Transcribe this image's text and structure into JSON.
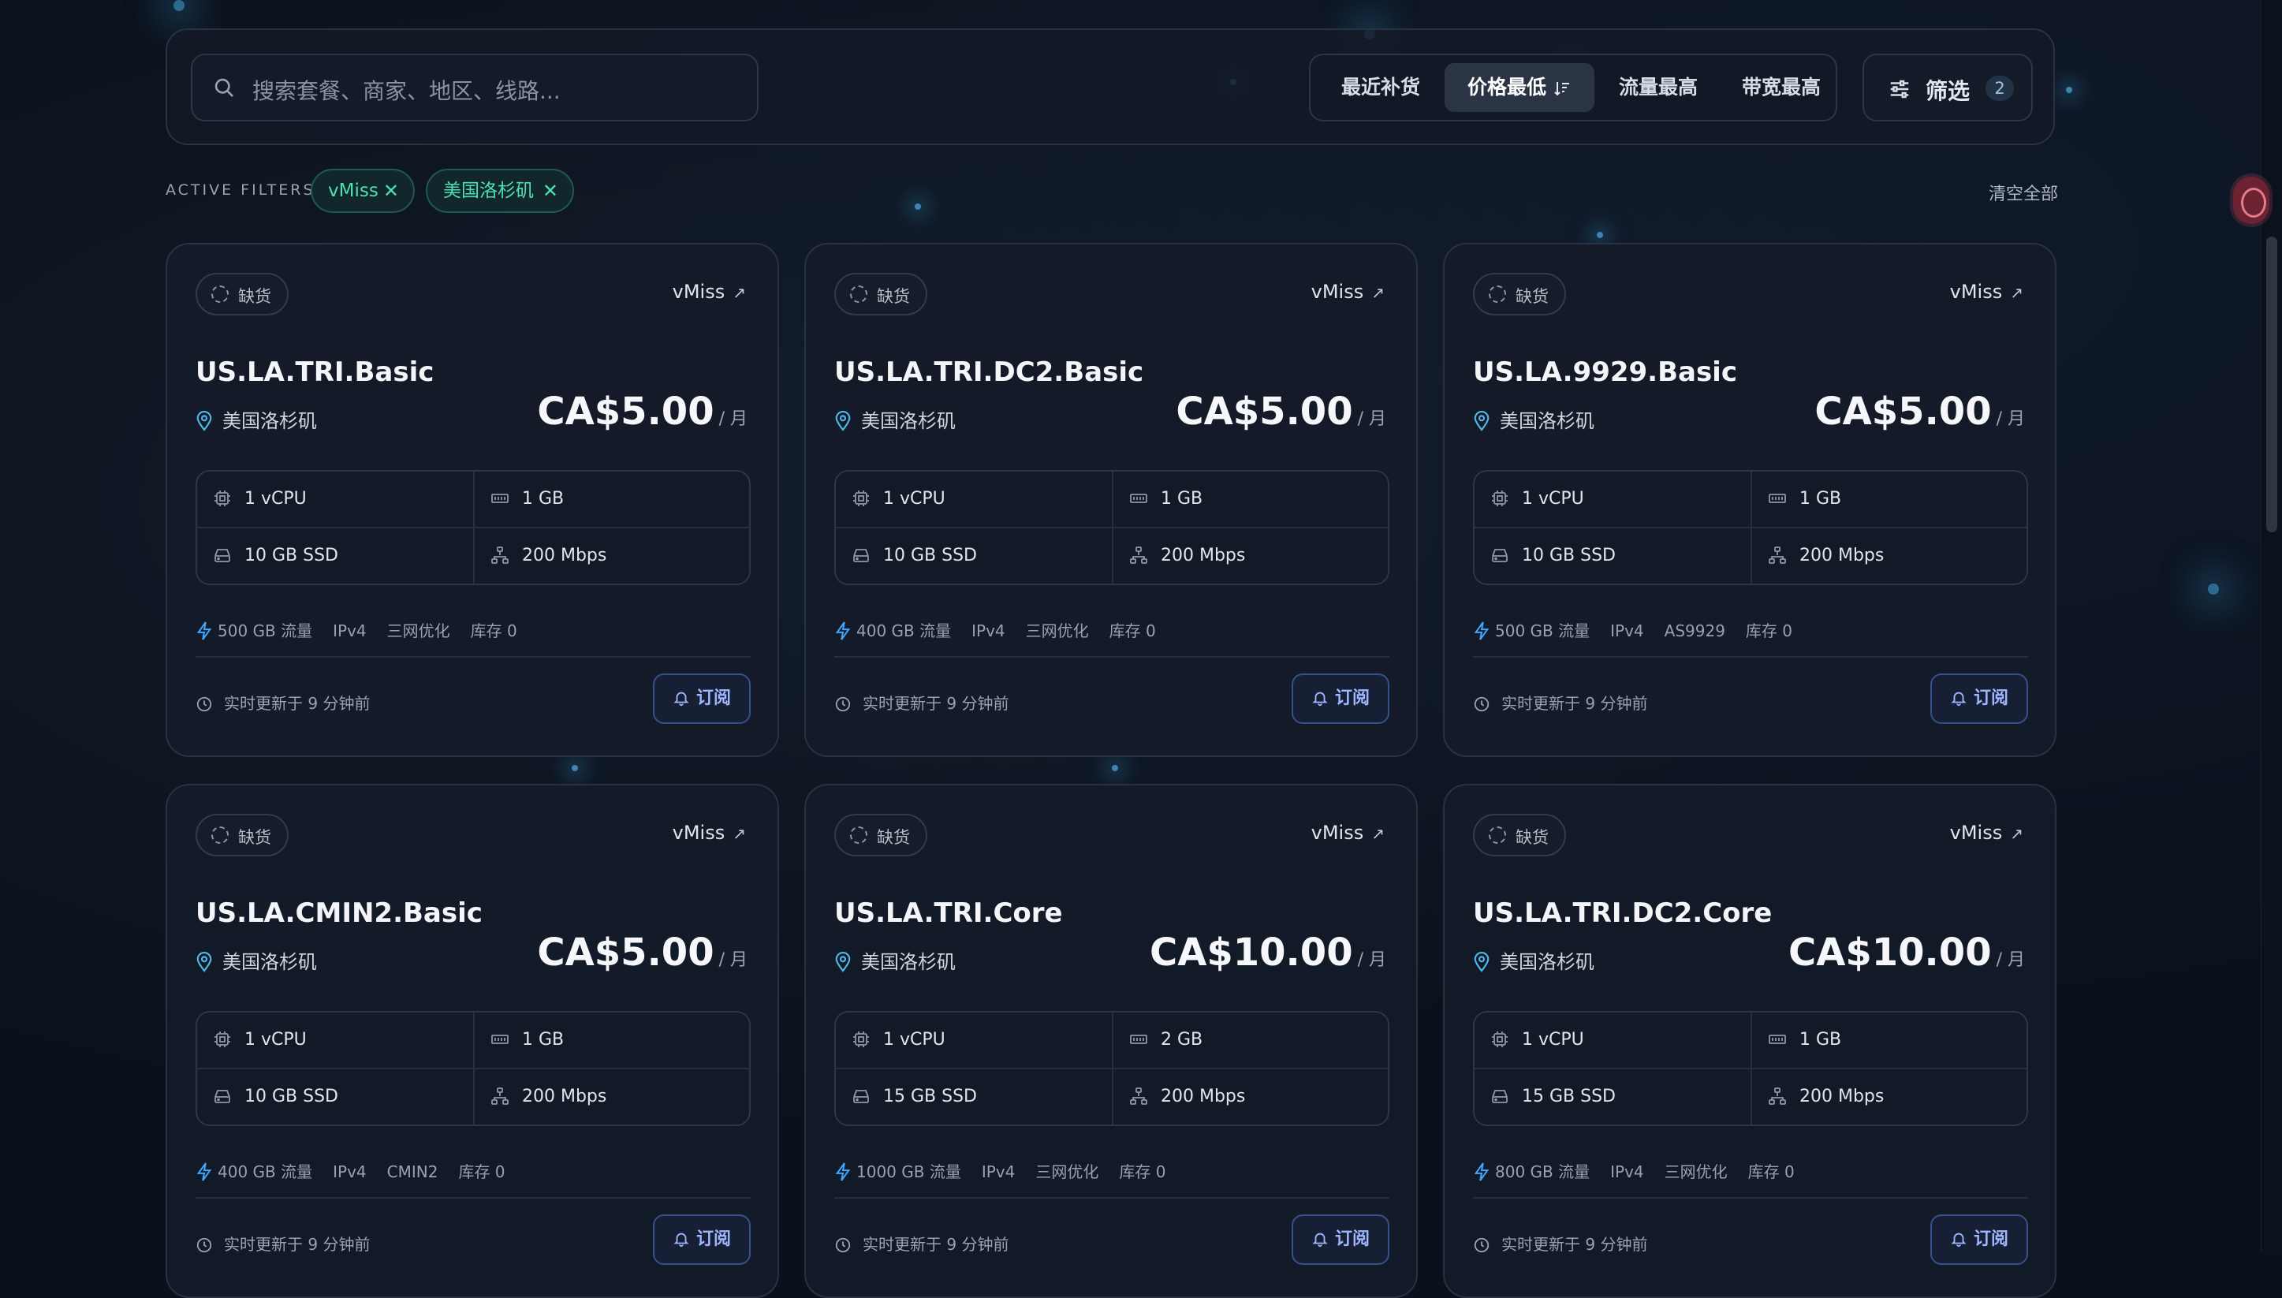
{
  "search": {
    "placeholder": "搜索套餐、商家、地区、线路..."
  },
  "sort": {
    "options": [
      {
        "label": "最近补货"
      },
      {
        "label": "价格最低",
        "active": true
      },
      {
        "label": "流量最高"
      },
      {
        "label": "带宽最高"
      }
    ]
  },
  "filter_button": {
    "label": "筛选",
    "count": "2"
  },
  "active_filters": {
    "label": "ACTIVE FILTERS",
    "chips": [
      {
        "label": "vMiss"
      },
      {
        "label": "美国洛杉矶"
      }
    ],
    "clear_label": "清空全部"
  },
  "colors": {
    "accent_green": "#4ee0b0",
    "accent_blue": "#9fb7ff",
    "location_pin": "#4fb8e8",
    "bolt": "#3fa7ff"
  },
  "cards": [
    {
      "status": "缺货",
      "vendor": "vMiss",
      "name": "US.LA.TRI.Basic",
      "location": "美国洛杉矶",
      "price": "CA$5.00",
      "unit": "/ 月",
      "cpu": "1 vCPU",
      "ram": "1 GB",
      "disk": "10 GB SSD",
      "bandwidth": "200 Mbps",
      "traffic": "500 GB 流量",
      "ip": "IPv4",
      "line": "三网优化",
      "stock": "库存 0",
      "updated": "实时更新于 9 分钟前",
      "subscribe": "订阅"
    },
    {
      "status": "缺货",
      "vendor": "vMiss",
      "name": "US.LA.TRI.DC2.Basic",
      "location": "美国洛杉矶",
      "price": "CA$5.00",
      "unit": "/ 月",
      "cpu": "1 vCPU",
      "ram": "1 GB",
      "disk": "10 GB SSD",
      "bandwidth": "200 Mbps",
      "traffic": "400 GB 流量",
      "ip": "IPv4",
      "line": "三网优化",
      "stock": "库存 0",
      "updated": "实时更新于 9 分钟前",
      "subscribe": "订阅"
    },
    {
      "status": "缺货",
      "vendor": "vMiss",
      "name": "US.LA.9929.Basic",
      "location": "美国洛杉矶",
      "price": "CA$5.00",
      "unit": "/ 月",
      "cpu": "1 vCPU",
      "ram": "1 GB",
      "disk": "10 GB SSD",
      "bandwidth": "200 Mbps",
      "traffic": "500 GB 流量",
      "ip": "IPv4",
      "line": "AS9929",
      "stock": "库存 0",
      "updated": "实时更新于 9 分钟前",
      "subscribe": "订阅"
    },
    {
      "status": "缺货",
      "vendor": "vMiss",
      "name": "US.LA.CMIN2.Basic",
      "location": "美国洛杉矶",
      "price": "CA$5.00",
      "unit": "/ 月",
      "cpu": "1 vCPU",
      "ram": "1 GB",
      "disk": "10 GB SSD",
      "bandwidth": "200 Mbps",
      "traffic": "400 GB 流量",
      "ip": "IPv4",
      "line": "CMIN2",
      "stock": "库存 0",
      "updated": "实时更新于 9 分钟前",
      "subscribe": "订阅"
    },
    {
      "status": "缺货",
      "vendor": "vMiss",
      "name": "US.LA.TRI.Core",
      "location": "美国洛杉矶",
      "price": "CA$10.00",
      "unit": "/ 月",
      "cpu": "1 vCPU",
      "ram": "2 GB",
      "disk": "15 GB SSD",
      "bandwidth": "200 Mbps",
      "traffic": "1000 GB 流量",
      "ip": "IPv4",
      "line": "三网优化",
      "stock": "库存 0",
      "updated": "实时更新于 9 分钟前",
      "subscribe": "订阅"
    },
    {
      "status": "缺货",
      "vendor": "vMiss",
      "name": "US.LA.TRI.DC2.Core",
      "location": "美国洛杉矶",
      "price": "CA$10.00",
      "unit": "/ 月",
      "cpu": "1 vCPU",
      "ram": "1 GB",
      "disk": "15 GB SSD",
      "bandwidth": "200 Mbps",
      "traffic": "800 GB 流量",
      "ip": "IPv4",
      "line": "三网优化",
      "stock": "库存 0",
      "updated": "实时更新于 9 分钟前",
      "subscribe": "订阅"
    }
  ]
}
